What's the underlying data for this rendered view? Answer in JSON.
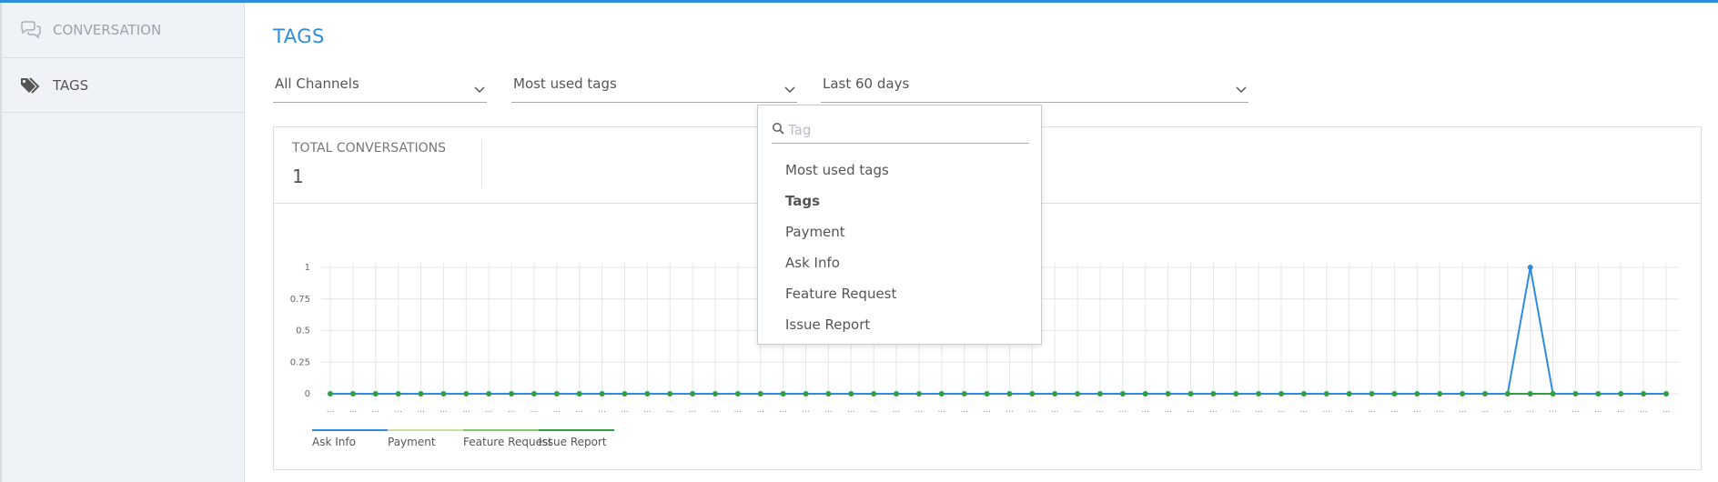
{
  "sidebar": {
    "items": [
      {
        "label": "CONVERSATION",
        "icon": "chat-bubbles-icon"
      },
      {
        "label": "TAGS",
        "icon": "tags-icon"
      }
    ]
  },
  "main": {
    "title": "TAGS",
    "filters": {
      "channel": "All Channels",
      "tag_mode": "Most used tags",
      "period": "Last 60 days"
    },
    "stats": {
      "total_label": "TOTAL CONVERSATIONS",
      "total_value": "1"
    }
  },
  "dropdown": {
    "search_placeholder": "Tag",
    "items": [
      "Most used tags",
      "Tags",
      "Payment",
      "Ask Info",
      "Feature Request",
      "Issue Report"
    ],
    "bold_item": "Tags"
  },
  "chart_data": {
    "type": "line",
    "y_ticks": [
      "1",
      "0.75",
      "0.5",
      "0.25",
      "0"
    ],
    "ylim": [
      0,
      1
    ],
    "x_tick_label": "...",
    "point_count": 60,
    "grid": true,
    "legend_position": "bottom-left",
    "series": [
      {
        "name": "Ask Info",
        "color": "#2e8ce0",
        "nonzero": [
          {
            "index": 53,
            "value": 1
          }
        ],
        "default": 0
      },
      {
        "name": "Payment",
        "color": "#c5e39a",
        "default": 0
      },
      {
        "name": "Feature Request",
        "color": "#7dc86a",
        "default": 0
      },
      {
        "name": "Issue Report",
        "color": "#2ea043",
        "default": 0
      }
    ]
  }
}
